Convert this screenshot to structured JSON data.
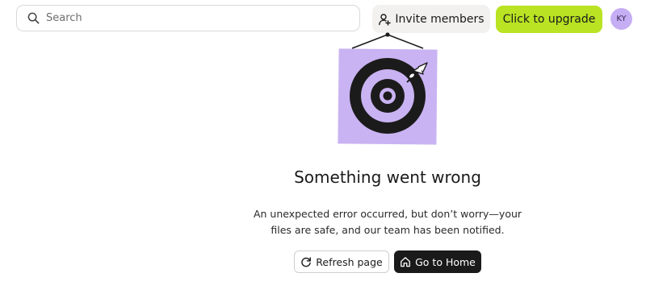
{
  "header": {
    "search": {
      "placeholder": "Search",
      "value": ""
    },
    "invite_label": "Invite members",
    "upgrade_label": "Click to upgrade",
    "avatar_initials": "KY"
  },
  "error": {
    "title": "Something went wrong",
    "message": "An unexpected error occurred, but don’t worry—your files are safe, and our team has been notified."
  },
  "actions": {
    "refresh_label": "Refresh page",
    "home_label": "Go to Home"
  },
  "icons": {
    "search": "search-icon",
    "invite": "add-user-icon",
    "refresh": "refresh-icon",
    "home": "home-icon",
    "illustration": "target-with-dart"
  },
  "colors": {
    "upgrade_accent": "#b9e323",
    "avatar_bg": "#c6aef4",
    "illustration_bg": "#c9b3f2",
    "target_ring": "#1b1b1b",
    "home_button_bg": "#1a1a1a",
    "invite_button_bg": "#f2f1ef"
  }
}
